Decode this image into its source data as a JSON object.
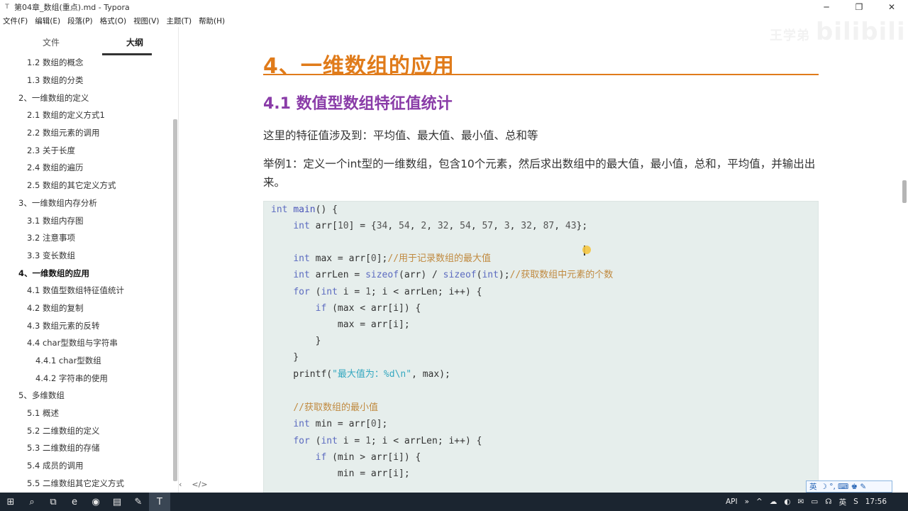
{
  "window": {
    "title": "第04章_数组(重点).md - Typora",
    "minimize": "─",
    "maximize": "❐",
    "close": "✕"
  },
  "menu": [
    "文件(F)",
    "编辑(E)",
    "段落(P)",
    "格式(O)",
    "视图(V)",
    "主题(T)",
    "帮助(H)"
  ],
  "sidebar": {
    "tabs": [
      "文件",
      "大纲"
    ],
    "outline": [
      {
        "label": "1.2 数组的概念",
        "level": 3
      },
      {
        "label": "1.3 数组的分类",
        "level": 3
      },
      {
        "label": "2、一维数组的定义",
        "level": 2
      },
      {
        "label": "2.1 数组的定义方式1",
        "level": 3
      },
      {
        "label": "2.2 数组元素的调用",
        "level": 3
      },
      {
        "label": "2.3 关于长度",
        "level": 3
      },
      {
        "label": "2.4 数组的遍历",
        "level": 3
      },
      {
        "label": "2.5 数组的其它定义方式",
        "level": 3
      },
      {
        "label": "3、一维数组内存分析",
        "level": 2
      },
      {
        "label": "3.1 数组内存图",
        "level": 3
      },
      {
        "label": "3.2 注意事项",
        "level": 3
      },
      {
        "label": "3.3 变长数组",
        "level": 3
      },
      {
        "label": "4、一维数组的应用",
        "level": 2,
        "active": true
      },
      {
        "label": "4.1 数值型数组特征值统计",
        "level": 3
      },
      {
        "label": "4.2 数组的复制",
        "level": 3
      },
      {
        "label": "4.3 数组元素的反转",
        "level": 3
      },
      {
        "label": "4.4 char型数组与字符串",
        "level": 3
      },
      {
        "label": "4.4.1 char型数组",
        "level": 4
      },
      {
        "label": "4.4.2 字符串的使用",
        "level": 4
      },
      {
        "label": "5、多维数组",
        "level": 2
      },
      {
        "label": "5.1 概述",
        "level": 3
      },
      {
        "label": "5.2 二维数组的定义",
        "level": 3
      },
      {
        "label": "5.3 二维数组的存储",
        "level": 3
      },
      {
        "label": "5.4 成员的调用",
        "level": 3
      },
      {
        "label": "5.5 二维数组其它定义方式",
        "level": 3
      }
    ],
    "footer_left": "‹",
    "footer_right": "</>"
  },
  "content": {
    "h1": "4、一维数组的应用",
    "h2": "4.1 数值型数组特征值统计",
    "p1": "这里的特征值涉及到：平均值、最大值、最小值、总和等",
    "p2": "举例1：定义一个int型的一维数组，包含10个元素，然后求出数组中的最大值，最小值，总和，平均值，并输出出来。"
  },
  "watermark": {
    "small": "王学弟",
    "big": "bilibili"
  },
  "ime": {
    "label": "英",
    "icons": "☽ °, ⌨ ♚ ✎"
  },
  "taskbar": {
    "icons": [
      "⊞",
      "⌕",
      "⧉",
      "e",
      "◉",
      "▤",
      "✎",
      "T"
    ],
    "tray": [
      "API",
      "»",
      "^",
      "☁",
      "◐",
      "✉",
      "▭",
      "☊",
      "英",
      "S"
    ],
    "time": "17:56"
  }
}
